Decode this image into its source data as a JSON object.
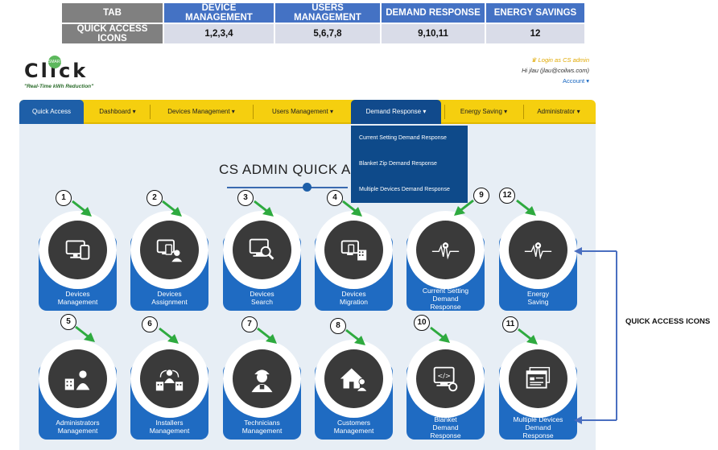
{
  "mapping_table": {
    "header_label": "TAB",
    "tabs": [
      "DEVICE MANAGEMENT",
      "USERS MANAGEMENT",
      "DEMAND RESPONSE",
      "ENERGY SAVINGS"
    ],
    "row_label": "QUICK ACCESS ICONS",
    "icons": [
      "1,2,3,4",
      "5,6,7,8",
      "9,10,11",
      "12"
    ]
  },
  "logo": {
    "text": "Click",
    "badge": "SMART",
    "tagline": "\"Real-Time kWh Reduction\""
  },
  "login": {
    "login_as": "Login as CS admin",
    "greeting": "Hi jlau (jlau@coilws.com)",
    "account": "Account"
  },
  "nav": {
    "items": [
      "Quick Access",
      "Dashboard",
      "Devices Management",
      "Users Management",
      "Demand Response",
      "Energy Saving",
      "Administrator"
    ],
    "caret": "▾"
  },
  "dropdown": {
    "items": [
      "Current Setting Demand Response",
      "Blanket Zip Demand Response",
      "Multiple Devices Demand Response"
    ]
  },
  "page": {
    "title": "CS ADMIN QUICK A"
  },
  "cards": [
    {
      "num": "1",
      "l1": "Devices",
      "l2": "Management",
      "l3": ""
    },
    {
      "num": "2",
      "l1": "Devices",
      "l2": "Assignment",
      "l3": ""
    },
    {
      "num": "3",
      "l1": "Devices",
      "l2": "Search",
      "l3": ""
    },
    {
      "num": "4",
      "l1": "Devices",
      "l2": "Migration",
      "l3": ""
    },
    {
      "num": "9",
      "l1": "Current Setting",
      "l2": "Demand",
      "l3": "Response"
    },
    {
      "num": "12",
      "l1": "Energy",
      "l2": "Saving",
      "l3": ""
    },
    {
      "num": "5",
      "l1": "Administrators",
      "l2": "Management",
      "l3": ""
    },
    {
      "num": "6",
      "l1": "Installers",
      "l2": "Management",
      "l3": ""
    },
    {
      "num": "7",
      "l1": "Technicians",
      "l2": "Management",
      "l3": ""
    },
    {
      "num": "8",
      "l1": "Customers",
      "l2": "Management",
      "l3": ""
    },
    {
      "num": "10",
      "l1": "Blanket",
      "l2": "Demand",
      "l3": "Response"
    },
    {
      "num": "11",
      "l1": "Multiple Devices",
      "l2": "Demand",
      "l3": "Response"
    }
  ],
  "annotation": {
    "label": "QUICK ACCESS ICONS"
  },
  "colors": {
    "nav_yellow": "#f5cf0f",
    "nav_blue": "#1e5fa8",
    "card_blue": "#1f6bc2",
    "icon_dark": "#3a3a3a",
    "arrow_green": "#2eaa3f"
  }
}
